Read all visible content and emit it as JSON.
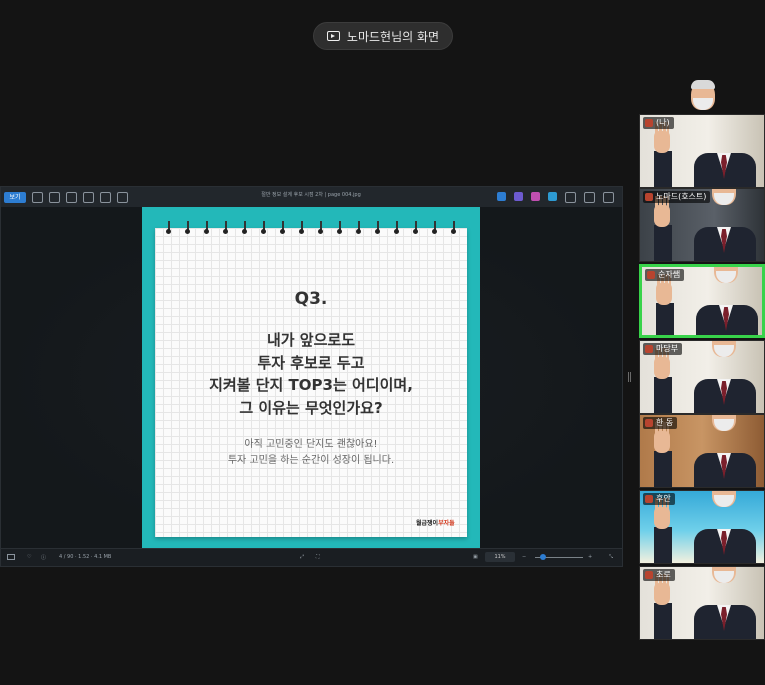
{
  "share_banner": {
    "icon": "screen-share-icon",
    "label": "노마드현님의 화면"
  },
  "shared_window": {
    "title": "절반 정보 설계 후보 시점 2차 | page 004.jpg",
    "toolbar": {
      "active_tab": "보기"
    },
    "slide": {
      "q_label": "Q3.",
      "question_lines": [
        "내가 앞으로도",
        "투자 후보로 두고",
        "지켜볼 단지 TOP3는 어디이며,",
        "그 이유는 무엇인가요?"
      ],
      "sub_lines": [
        "아직 고민중인 단지도 괜찮아요!",
        "투자 고민을 하는 순간이 성장이 됩니다."
      ],
      "logo_dark": "월급쟁이",
      "logo_red": "부자들"
    },
    "statusbar": {
      "info": "4 / 90 · 1.52 · 4.1 MB",
      "zoom": "11%"
    }
  },
  "participants": [
    {
      "name": "(나)"
    },
    {
      "name": "노마드(호스트)"
    },
    {
      "name": "순자쌤"
    },
    {
      "name": "마당부"
    },
    {
      "name": "한 동"
    },
    {
      "name": "후안"
    },
    {
      "name": "초로"
    }
  ],
  "colors": {
    "accent": "#2d7dd2",
    "slide_bg": "#23b8b9",
    "speaking": "#38d34a",
    "logo_red": "#d23a1f"
  }
}
